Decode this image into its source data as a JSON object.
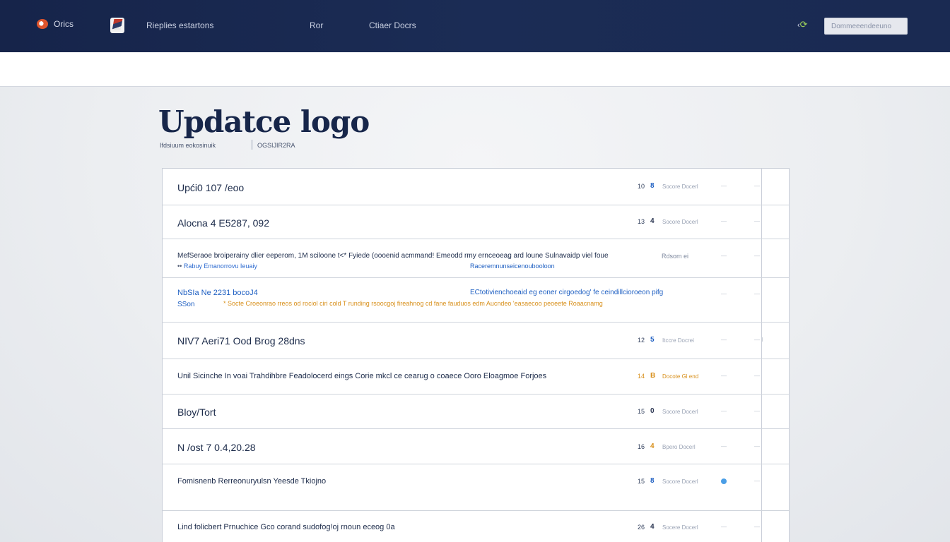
{
  "nav": {
    "brand": "Orics",
    "brand_icon": "brand-logo-icon",
    "app_icon": "app-icon",
    "links": [
      "Rieplies estartons",
      "Ror",
      "Ctiaer Docrs"
    ],
    "refresh_icon": "refresh-icon",
    "search_placeholder": "Dommeeendeeuno",
    "accent": "#9ccf5a"
  },
  "header": {
    "title": "Updatce logo",
    "meta_left": "Ifdsiuum eokosinuik",
    "meta_right": "OGSIJIR2RA"
  },
  "colors": {
    "topbar": "#16244a",
    "link_blue": "#1e5fc2",
    "warning_gold": "#d8901c",
    "dot_blue": "#4a9ee6"
  },
  "rows": [
    {
      "title": "Upći0 107 /eoo",
      "num": "10",
      "ver": "8",
      "status": "Socore Docerl",
      "dash": "—",
      "dash2": "—"
    },
    {
      "title": "Alocna 4 E5287, 092",
      "num": "13",
      "ver": "4",
      "status": "Socore Docerl",
      "dash": "—",
      "dash2": "—"
    },
    {
      "title": "MefSeraoe broiperainy dlier eeperom, 1M sciloone t<* Fyiede (oooenid acmmand! Emeodd rmy ernceoeag ard loune Sulnavaidp viel foue",
      "title_tail": "Rdsom ei",
      "sub_mark": "••",
      "sub": "Rabuy Emanorrovu Ieuaiy",
      "sub_right": "Raceremnunseicenoubooloon",
      "dash": "—",
      "dash2": "—"
    },
    {
      "title": "NbSIa Ne 2231 bocoJ4",
      "title_right": "ECtotivienchoeaid eg eoner cirgoedog' fe ceindillcioroeon pifg",
      "sub": "SSon",
      "sub_right": "* Socte Croeonrao rreos od rociol ciri cold T runding rsoocgoj fireahnog cd fane fauduos edm Aucndeo 'easaecoo peoeete Roaacnamg",
      "dash": "—",
      "dash2": "—"
    },
    {
      "title": "NIV7 Aeri71 Ood Brog 28dns",
      "num": "12",
      "ver": "5",
      "status": "Itccre Docrei",
      "dash": "—",
      "dash2": "— I"
    },
    {
      "title": "Unil Sicinche  In voai Trahdihbre Feadolocerd eings Corie mkcl ce cearug o coaece Ooro Eloagmoe Forjoes",
      "num": "14",
      "ver": "B",
      "status": "Docote Gl end",
      "dash": "—",
      "dash2": "—"
    },
    {
      "title": "Bloy/Tort",
      "num": "15",
      "ver": "0",
      "status": "Socore Docerl",
      "dash": "—",
      "dash2": "—"
    },
    {
      "title": "N /ost 7  0.4,20.28",
      "num": "16",
      "ver": "4",
      "status": "Bpero Docerl",
      "dash": "—",
      "dash2": "—"
    },
    {
      "title": "Fomisnenb Rerreonuryulsn Yeesde Tkiojno",
      "num": "15",
      "ver": "8",
      "status": "Socore Docerl",
      "dot": "status-dot",
      "dash2": "—"
    },
    {
      "title": "Lind folicbert Prnuchice Gco corand sudofog!oj rnoun eceog 0a",
      "num": "26",
      "ver": "4",
      "status": "Socere Docerl",
      "dash": "—",
      "dash2": "—"
    }
  ]
}
